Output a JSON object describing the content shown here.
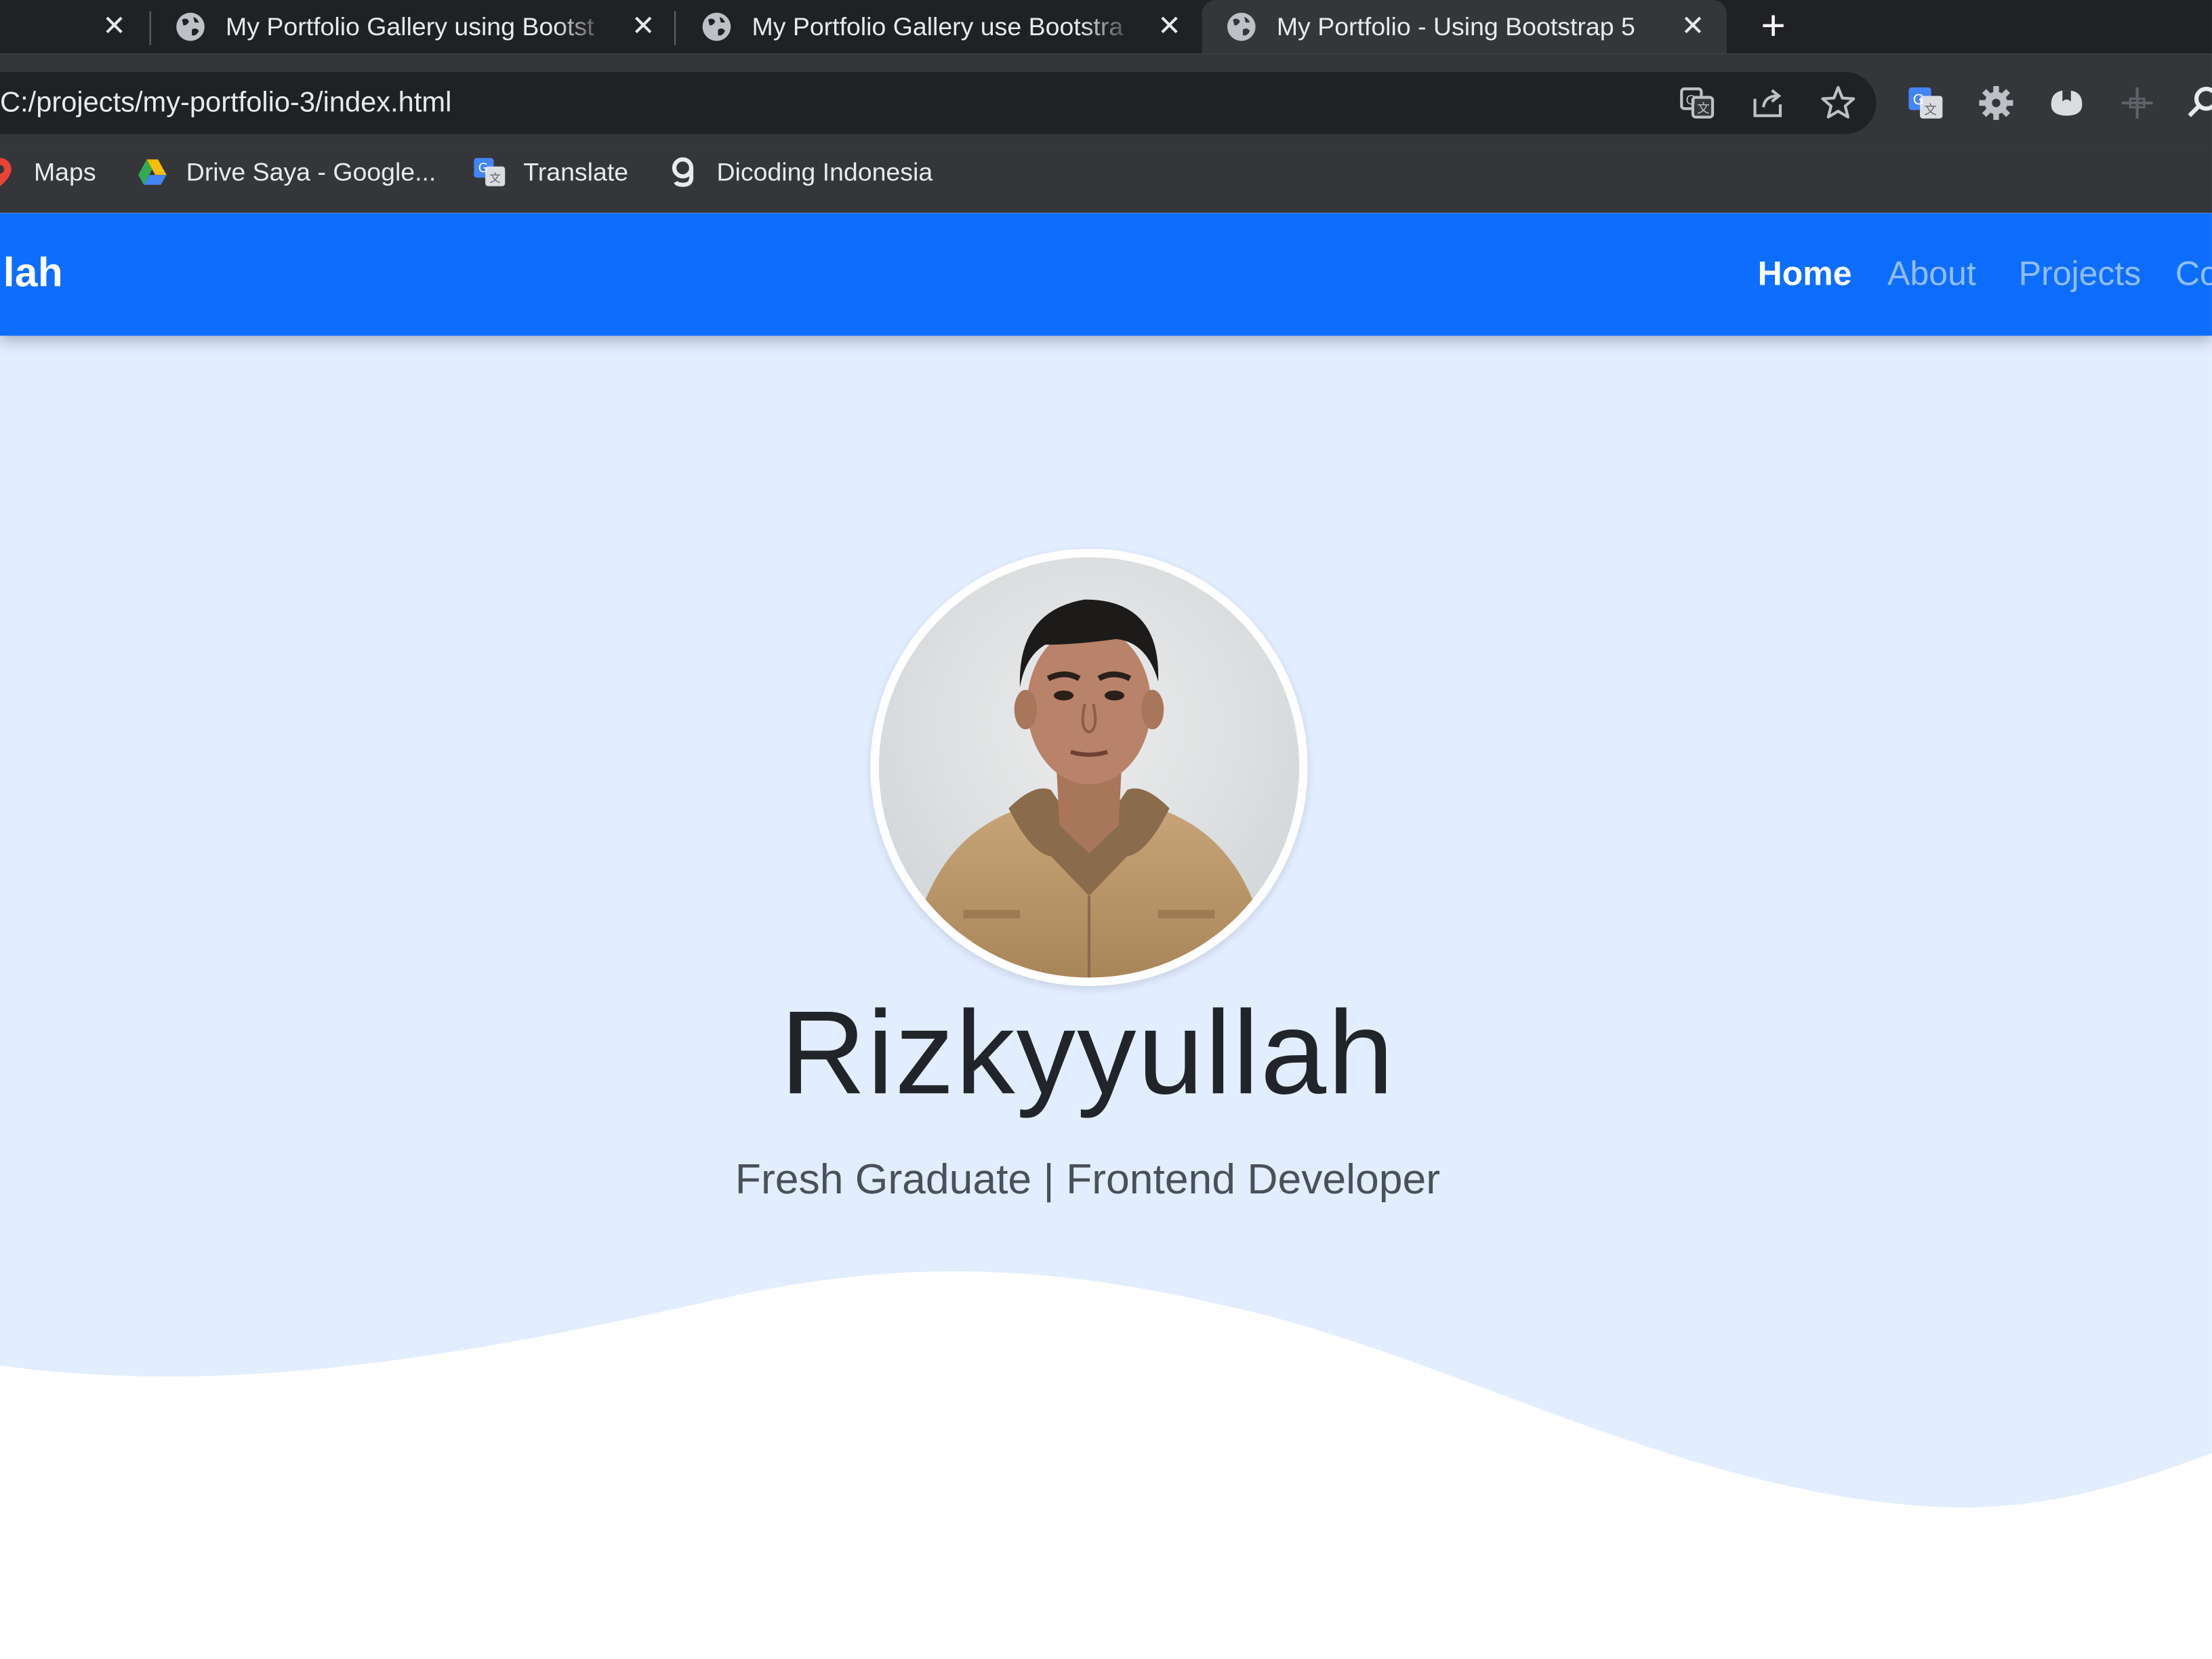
{
  "browser": {
    "tabs": [
      {
        "title": "My Portfolio Gallery using Bootst"
      },
      {
        "title": "My Portfolio Gallery use Bootstra"
      },
      {
        "title": "My Portfolio - Using Bootstrap 5"
      }
    ],
    "url": "C:/projects/my-portfolio-3/index.html",
    "bookmarks": [
      {
        "label": "Maps"
      },
      {
        "label": "Drive Saya - Google..."
      },
      {
        "label": "Translate"
      },
      {
        "label": "Dicoding Indonesia"
      }
    ]
  },
  "page": {
    "brand": "llah",
    "nav": [
      {
        "label": "Home"
      },
      {
        "label": "About"
      },
      {
        "label": "Projects"
      },
      {
        "label": "Co"
      }
    ],
    "hero": {
      "name": "Rizkyyullah",
      "subtitle": "Fresh Graduate | Frontend Developer"
    }
  },
  "colors": {
    "navbar": "#0d6efd",
    "hero_background": "#e2edff",
    "tabstrip": "#202124",
    "toolbar": "#35363a"
  }
}
